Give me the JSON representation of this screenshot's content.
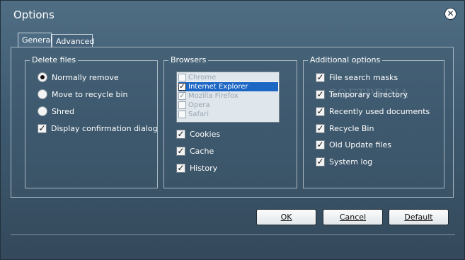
{
  "window": {
    "title": "Options",
    "close_symbol": "✕"
  },
  "tabs": [
    {
      "label": "General",
      "active": true
    },
    {
      "label": "Advanced",
      "active": false
    }
  ],
  "delete_files": {
    "title": "Delete files",
    "options": [
      {
        "label": "Normally remove",
        "selected": true
      },
      {
        "label": "Move to recycle bin",
        "selected": false
      },
      {
        "label": "Shred",
        "selected": false
      }
    ],
    "confirm": {
      "label": "Display confirmation dialog",
      "checked": true
    }
  },
  "browsers": {
    "title": "Browsers",
    "list": [
      {
        "label": "Chrome",
        "checked": false,
        "selected": false
      },
      {
        "label": "Internet Explorer",
        "checked": true,
        "selected": true
      },
      {
        "label": "Mozilla Firefox",
        "checked": true,
        "selected": false
      },
      {
        "label": "Opera",
        "checked": false,
        "selected": false
      },
      {
        "label": "Safari",
        "checked": false,
        "selected": false
      }
    ],
    "options": [
      {
        "label": "Cookies",
        "checked": true
      },
      {
        "label": "Cache",
        "checked": true
      },
      {
        "label": "History",
        "checked": true
      }
    ]
  },
  "additional": {
    "title": "Additional options",
    "options": [
      {
        "label": "File search masks",
        "checked": true
      },
      {
        "label": "Temporary directory",
        "checked": true
      },
      {
        "label": "Recently used documents",
        "checked": true
      },
      {
        "label": "Recycle Bin",
        "checked": true
      },
      {
        "label": "Old Update files",
        "checked": true
      },
      {
        "label": "System log",
        "checked": true
      }
    ]
  },
  "buttons": {
    "ok": "OK",
    "cancel": "Cancel",
    "default": "Default"
  },
  "watermark": "SOFTPEDIA",
  "colors": {
    "background": "#3e5a70",
    "selection": "#1c66c4"
  }
}
